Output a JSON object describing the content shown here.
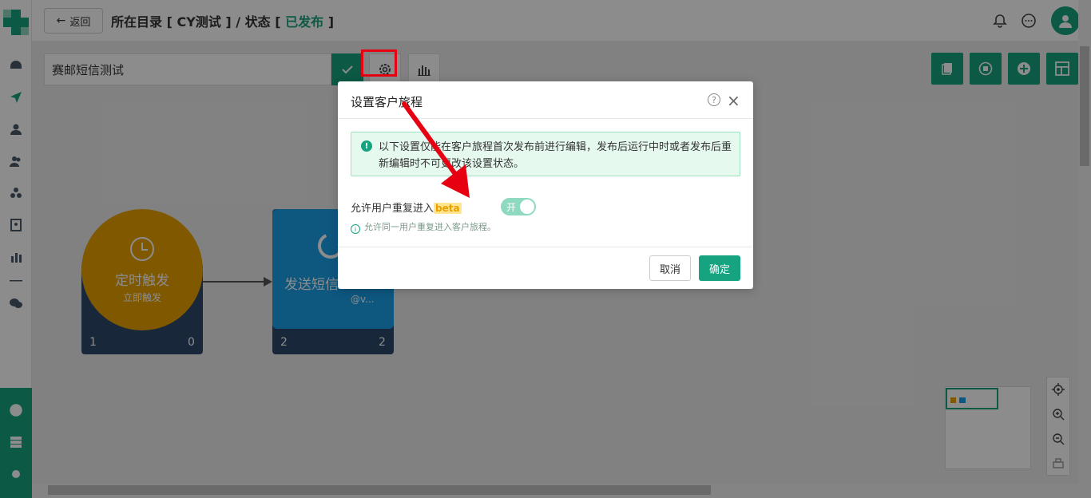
{
  "header": {
    "back_label": "返回",
    "title_prefix": "所在目录 [ CY测试 ] / 状态 [ ",
    "status": "已发布",
    "title_suffix": " ]"
  },
  "toolbar": {
    "journey_name": "赛邮短信测试"
  },
  "nodes": [
    {
      "name": "定时触发",
      "sub": "立即触发",
      "count_left": "1",
      "count_right": "0"
    },
    {
      "name": "发送短信",
      "account": "@v...",
      "count_left": "2",
      "count_right": "2"
    }
  ],
  "modal": {
    "title": "设置客户旅程",
    "help": "?",
    "close": "×",
    "alert_text": "以下设置仅能在客户旅程首次发布前进行编辑，发布后运行中时或者发布后重新编辑时不可更改该设置状态。",
    "option_label": "允许用户重复进入",
    "beta": "beta",
    "toggle_text": "开",
    "hint": "允许同一用户重复进入客户旅程。",
    "cancel": "取消",
    "ok": "确定"
  },
  "colors": {
    "primary": "#16a37f",
    "trigger_node": "#e8a000",
    "sms_node": "#1a9ee8",
    "node_footer": "#2c4a6b",
    "highlight": "#e60012"
  }
}
